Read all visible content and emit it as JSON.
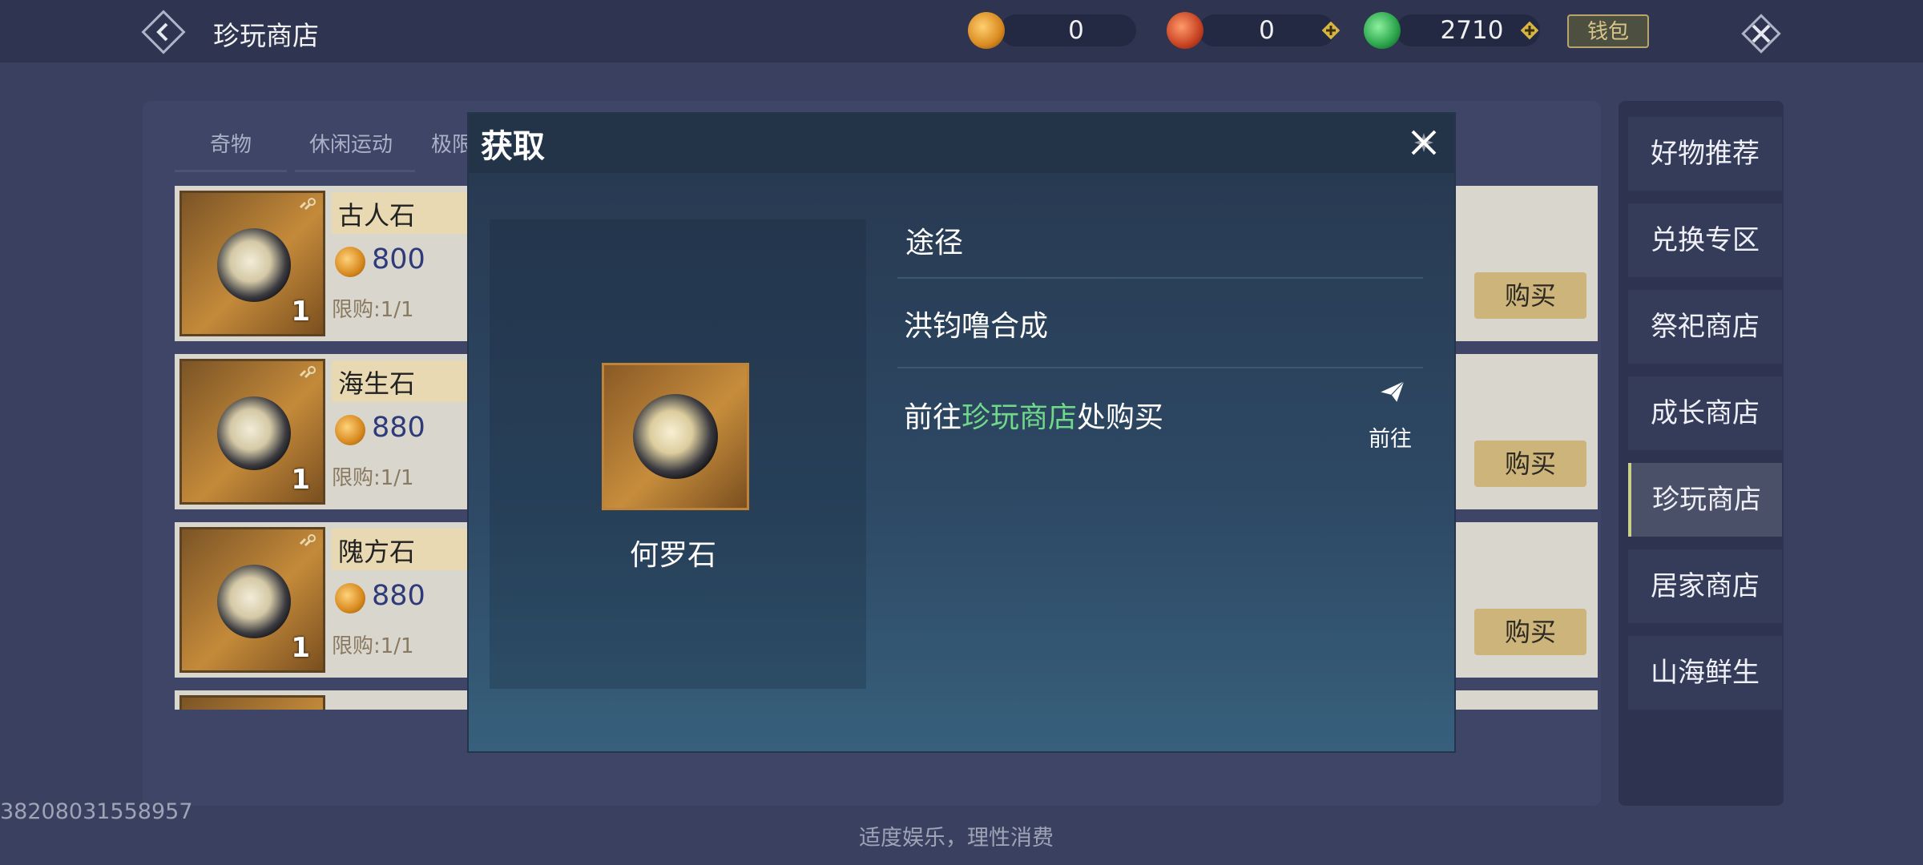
{
  "header": {
    "title": "珍玩商店",
    "currencies": [
      {
        "icon": "copper-coin-icon",
        "value": "0"
      },
      {
        "icon": "red-coin-icon",
        "value": "0"
      },
      {
        "icon": "jade-coin-icon",
        "value": "2710"
      }
    ],
    "wallet_label": "钱包"
  },
  "tabs": [
    "奇物",
    "休闲运动",
    "极限"
  ],
  "items": [
    {
      "name": "古人石",
      "price": "800",
      "limit": "限购:1/1",
      "qty": "1",
      "buy": "购买"
    },
    {
      "name": "海生石",
      "price": "880",
      "limit": "限购:1/1",
      "qty": "1",
      "buy": "购买"
    },
    {
      "name": "隗方石",
      "price": "880",
      "limit": "限购:1/1",
      "qty": "1",
      "buy": "购买"
    }
  ],
  "side_menu": [
    "好物推荐",
    "兑换专区",
    "祭祀商店",
    "成长商店",
    "珍玩商店",
    "居家商店",
    "山海鲜生"
  ],
  "user_id": "38208031558957",
  "notice": "适度娱乐，理性消费",
  "modal": {
    "title": "获取",
    "item_name": "何罗石",
    "route_label": "途径",
    "route_1": "洪钧噜合成",
    "route_2_pre": "前往",
    "route_2_highlight": "珍玩商店",
    "route_2_post": "处购买",
    "go_label": "前往"
  },
  "colors": {
    "accent_green": "#6fd88a",
    "buy_gold": "#cdb47a"
  }
}
